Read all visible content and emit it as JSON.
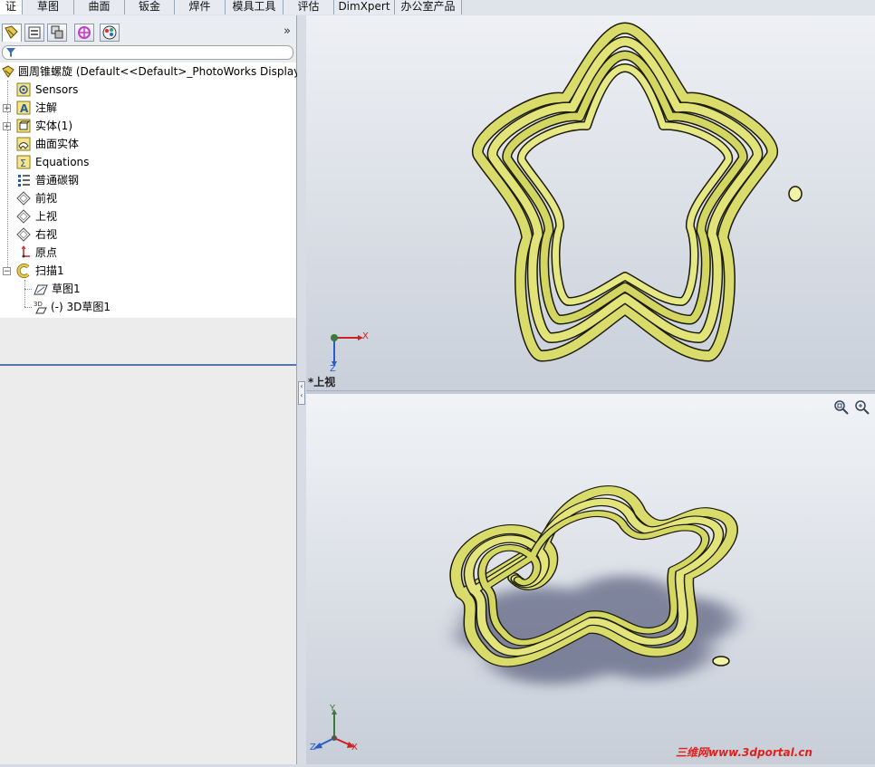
{
  "command_tabs": [
    "证",
    "草图",
    "曲面",
    "钣金",
    "焊件",
    "模具工具",
    "评估",
    "DimXpert",
    "办公室产品"
  ],
  "panel_tabs": [
    "feature-manager-icon",
    "property-manager-icon",
    "configuration-manager-icon",
    "dimxpert-manager-icon",
    "display-manager-icon"
  ],
  "panel_expand": "»",
  "tree": {
    "root_label": "圆周锥螺旋  (Default<<Default>_PhotoWorks Display",
    "items": [
      {
        "label": "Sensors",
        "icon": "sensors-icon"
      },
      {
        "label": "注解",
        "icon": "annotations-icon"
      },
      {
        "label": "实体(1)",
        "icon": "solid-bodies-icon"
      },
      {
        "label": "曲面实体",
        "icon": "surface-bodies-icon"
      },
      {
        "label": "Equations",
        "icon": "equations-icon"
      },
      {
        "label": "普通碳钢",
        "icon": "material-icon"
      },
      {
        "label": "前视",
        "icon": "plane-icon"
      },
      {
        "label": "上视",
        "icon": "plane-icon"
      },
      {
        "label": "右视",
        "icon": "plane-icon"
      },
      {
        "label": "原点",
        "icon": "origin-icon"
      },
      {
        "label": "扫描1",
        "icon": "sweep-icon"
      },
      {
        "label": "草图1",
        "icon": "sketch-icon"
      },
      {
        "label": "(-) 3D草图1",
        "icon": "3d-sketch-icon"
      }
    ]
  },
  "viewport_top": {
    "view_label": "*上视",
    "triad": {
      "x": "X",
      "z": "Z"
    }
  },
  "viewport_bottom": {
    "triad": {
      "x": "X",
      "y": "Y",
      "z": "Z"
    },
    "zoom_icons": [
      "zoom-to-fit-icon",
      "zoom-to-area-icon"
    ]
  },
  "watermark": "三维网www.3dportal.cn",
  "colors": {
    "model": "#d9dc6a",
    "model_edge": "#1b1b06",
    "tree_separator": "#4f79ad",
    "watermark": "#e2201b"
  }
}
